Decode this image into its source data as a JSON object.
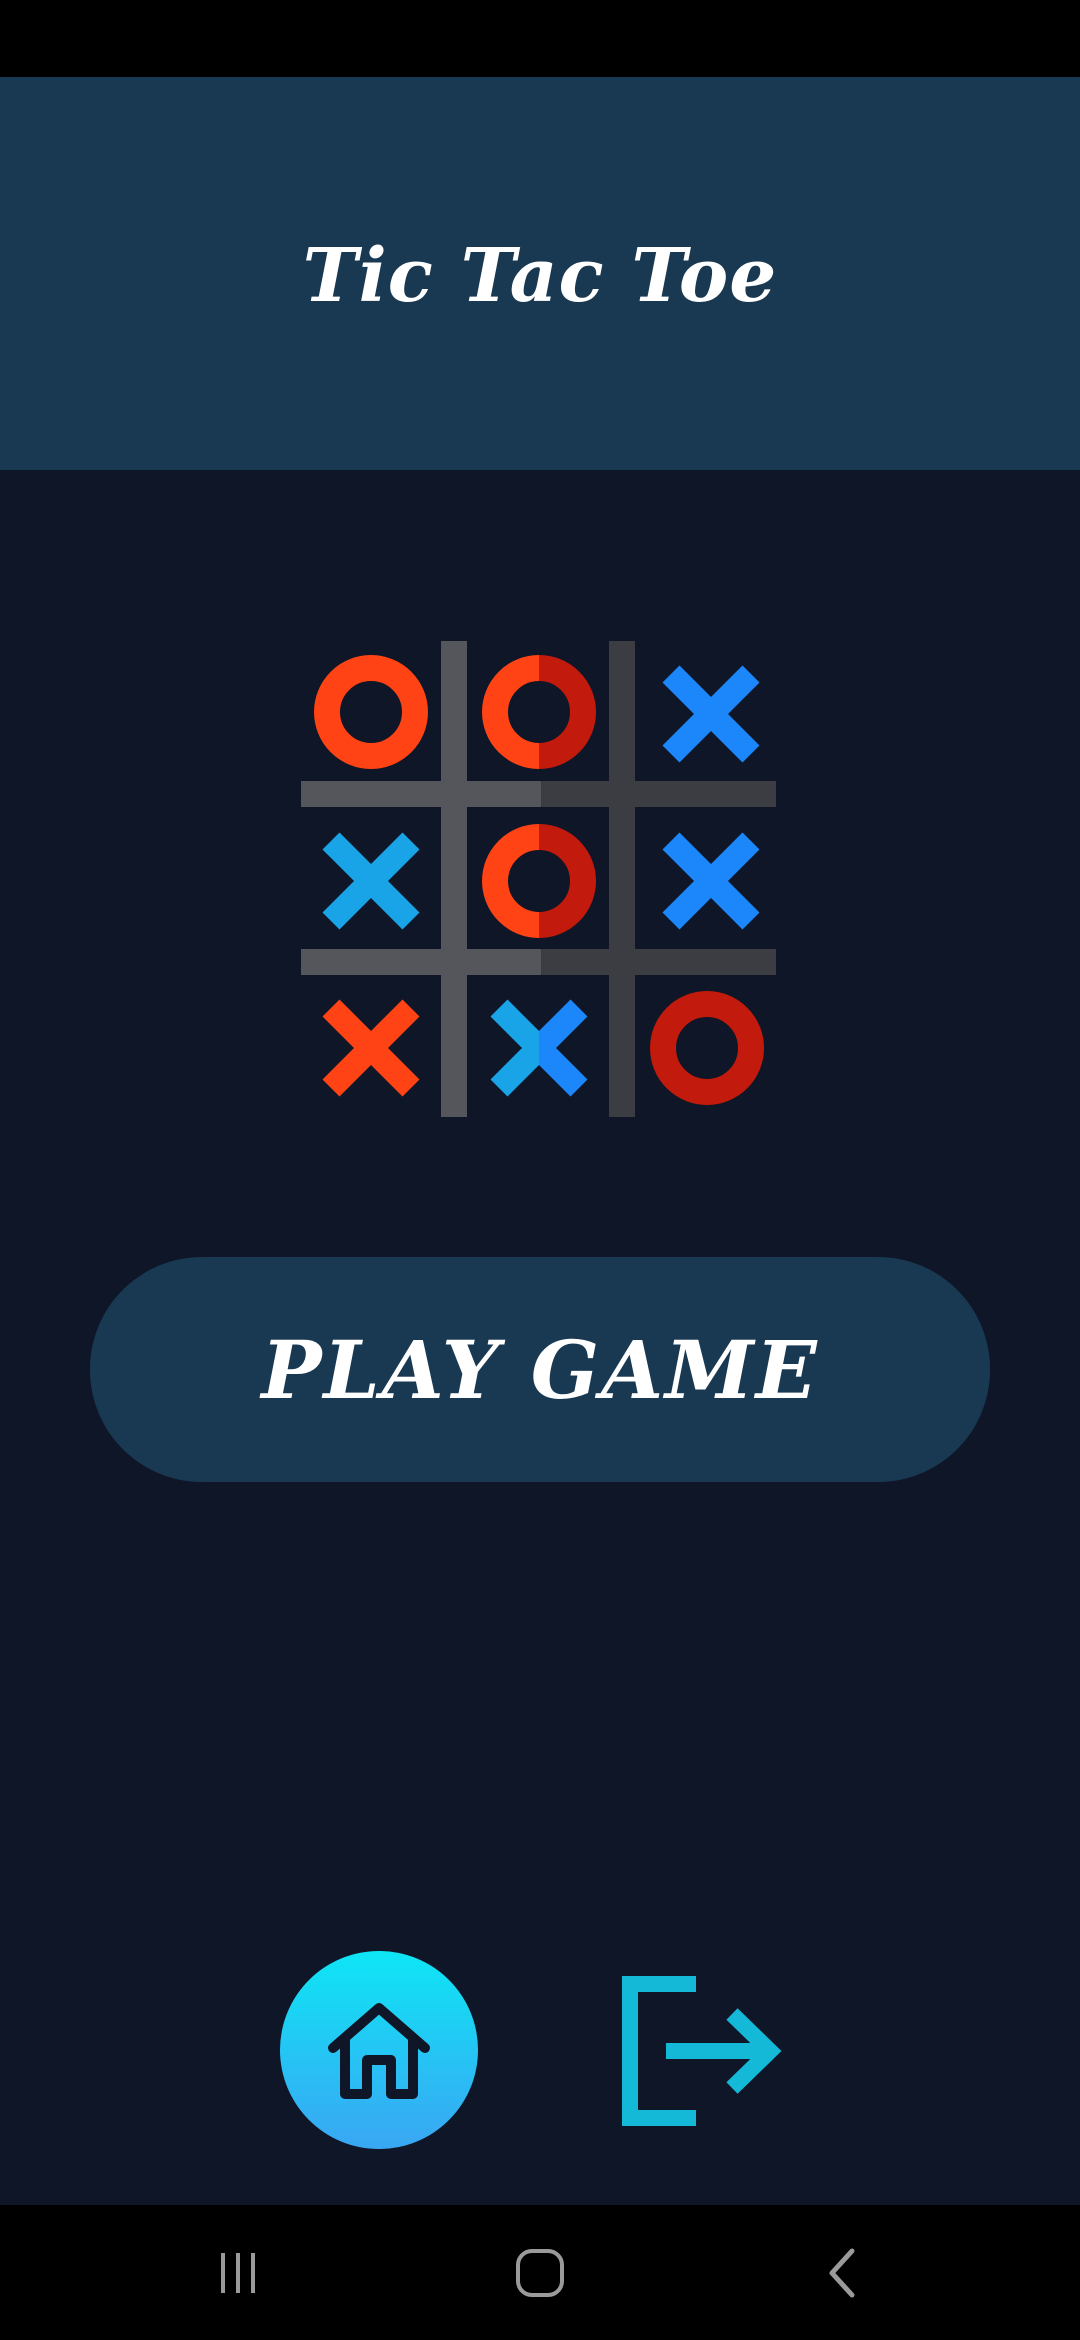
{
  "header": {
    "title": "Tic Tac Toe"
  },
  "board": {
    "cells": [
      [
        "O",
        "O",
        "X"
      ],
      [
        "X",
        "O",
        "X"
      ],
      [
        "X",
        "X",
        "O"
      ]
    ]
  },
  "buttons": {
    "play_label": "PLAY GAME"
  },
  "icons": {
    "home": "home-icon",
    "exit": "exit-icon",
    "recents": "recents-icon",
    "nav_home": "nav-home-icon",
    "back": "back-icon"
  },
  "colors": {
    "background": "#0e1627",
    "header": "#193851",
    "grid_light": "#55555c",
    "grid_dark": "#3c3c43",
    "o_orange": "#ff4314",
    "o_red": "#c21a0c",
    "x_blue": "#1c86fb",
    "x_cyan": "#18a4e6",
    "x_orange": "#ff4314",
    "home_gradient_top": "#0ee6f5",
    "home_gradient_bottom": "#3aa6f3",
    "exit_color": "#13b9d7"
  }
}
